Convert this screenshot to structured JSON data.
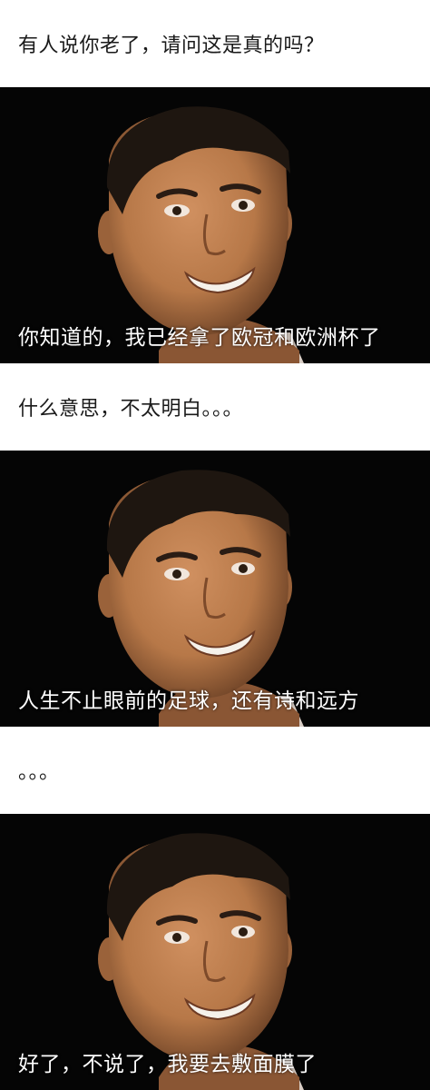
{
  "panels": [
    {
      "kind": "text",
      "text": "有人说你老了，请问这是真的吗？"
    },
    {
      "kind": "photo",
      "caption": "你知道的，我已经拿了欧冠和欧洲杯了"
    },
    {
      "kind": "text",
      "text": "什么意思，不太明白。。。"
    },
    {
      "kind": "photo",
      "caption": "人生不止眼前的足球，还有诗和远方"
    },
    {
      "kind": "text",
      "text": "。。。"
    },
    {
      "kind": "photo",
      "caption": "好了，不说了，我要去敷面膜了"
    }
  ],
  "colors": {
    "photo_background": "#050505",
    "caption": "#ffffff",
    "question": "#1a1a1a",
    "skin": "#b77848",
    "hair": "#1e1610"
  }
}
